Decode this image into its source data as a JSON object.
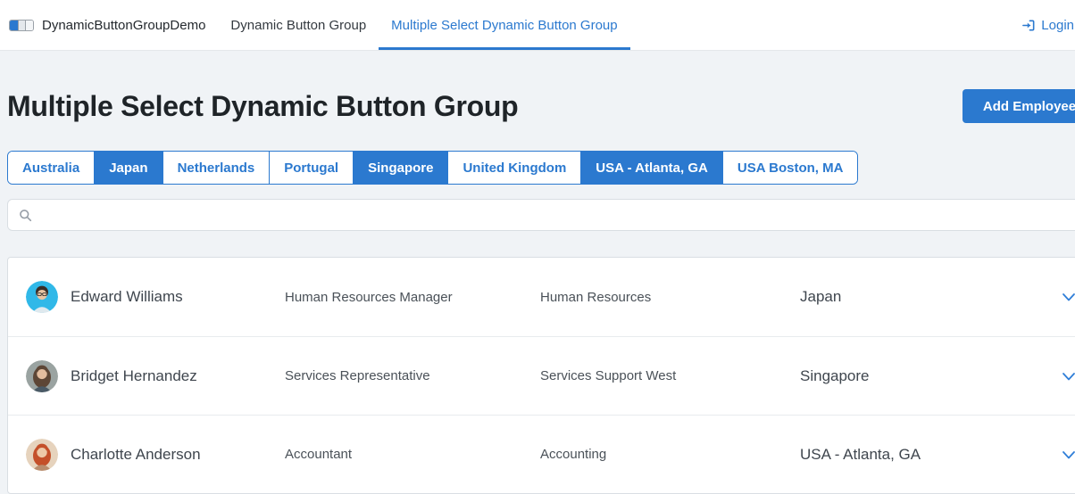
{
  "navbar": {
    "brand": "DynamicButtonGroupDemo",
    "links": [
      {
        "label": "Dynamic Button Group",
        "active": false
      },
      {
        "label": "Multiple Select Dynamic Button Group",
        "active": true
      }
    ],
    "login_label": "Login"
  },
  "page": {
    "title": "Multiple Select Dynamic Button Group",
    "add_button_label": "Add Employee"
  },
  "country_filter": {
    "options": [
      {
        "label": "Australia",
        "selected": false
      },
      {
        "label": "Japan",
        "selected": true
      },
      {
        "label": "Netherlands",
        "selected": false
      },
      {
        "label": "Portugal",
        "selected": false
      },
      {
        "label": "Singapore",
        "selected": true
      },
      {
        "label": "United Kingdom",
        "selected": false
      },
      {
        "label": "USA - Atlanta, GA",
        "selected": true
      },
      {
        "label": "USA Boston, MA",
        "selected": false
      }
    ]
  },
  "search": {
    "value": "",
    "placeholder": "",
    "icon": "search-icon"
  },
  "employees": [
    {
      "name": "Edward Williams",
      "job_title": "Human Resources Manager",
      "department": "Human Resources",
      "country": "Japan",
      "avatar": {
        "background": "#30b8e8",
        "hair": "#3a2e28",
        "skin": "#e9c5a4",
        "shirt": "#dfe9ee",
        "hair_style": "short",
        "glasses": true
      }
    },
    {
      "name": "Bridget Hernandez",
      "job_title": "Services Representative",
      "department": "Services Support West",
      "country": "Singapore",
      "avatar": {
        "background": "#9aa3a1",
        "hair": "#5d4636",
        "skin": "#e3bd9f",
        "shirt": "#4a5a66",
        "hair_style": "long",
        "glasses": false
      }
    },
    {
      "name": "Charlotte Anderson",
      "job_title": "Accountant",
      "department": "Accounting",
      "country": "USA - Atlanta, GA",
      "avatar": {
        "background": "#e6d3bd",
        "hair": "#c4502a",
        "skin": "#edc9a8",
        "shirt": "#b98d6e",
        "hair_style": "long",
        "glasses": false
      }
    }
  ],
  "icons": {
    "brand": "button-group-icon",
    "login": "sign-in-icon",
    "search": "search-icon",
    "row_expand": "chevron-down-icon"
  },
  "colors": {
    "primary": "#2b79cf",
    "page_background": "#f0f3f6",
    "surface": "#ffffff",
    "card_border": "#d9dee3",
    "row_divider": "#e8ebee",
    "navbar_border": "#e4e7ea",
    "title_text": "#1f2428",
    "body_text": "#3f464e",
    "secondary_text": "#4a5158",
    "selected_button_text": "#ffffff"
  }
}
